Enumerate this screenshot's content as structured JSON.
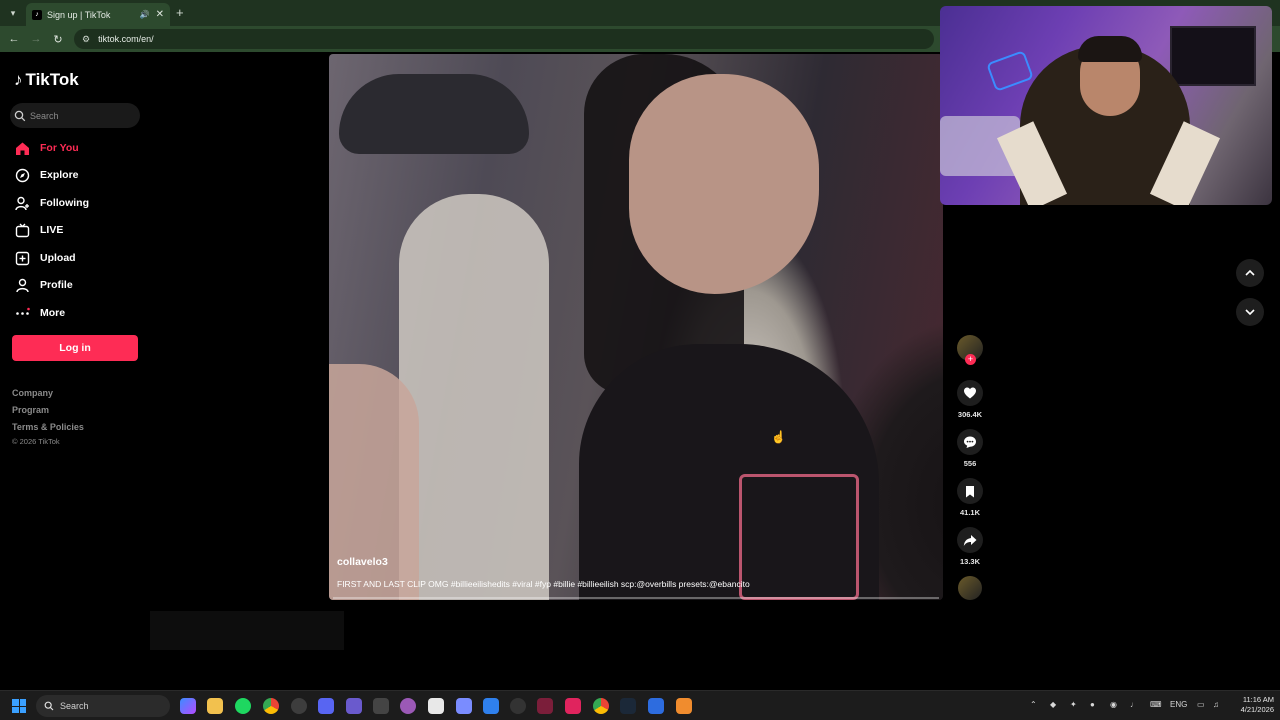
{
  "browser": {
    "tab_title": "Sign up | TikTok",
    "url": "tiktok.com/en/"
  },
  "sidebar": {
    "logo_text": "TikTok",
    "search_placeholder": "Search",
    "items": [
      {
        "label": "For You",
        "icon": "home-icon",
        "active": true
      },
      {
        "label": "Explore",
        "icon": "compass-icon"
      },
      {
        "label": "Following",
        "icon": "user-add-icon"
      },
      {
        "label": "LIVE",
        "icon": "live-tv-icon"
      },
      {
        "label": "Upload",
        "icon": "upload-plus-icon"
      },
      {
        "label": "Profile",
        "icon": "profile-icon"
      },
      {
        "label": "More",
        "icon": "more-dots-icon"
      }
    ],
    "login_label": "Log in",
    "footer_links": [
      "Company",
      "Program",
      "Terms & Policies"
    ],
    "copyright": "© 2026 TikTok"
  },
  "video": {
    "username": "collavelo3",
    "description": "FIRST AND LAST CLIP OMG #billieeilishedits #viral #fyp #billie #billieeilish scp:@overbills presets:@ebancito",
    "progress": 0.0
  },
  "actions": {
    "likes": "306.4K",
    "comments": "556",
    "saves": "41.1K",
    "shares": "13.3K"
  },
  "taskbar": {
    "search_label": "Search",
    "language": "ENG",
    "time": "11:16 AM",
    "date": "4/21/2026"
  },
  "colors": {
    "accent": "#fe2c55",
    "browser_chrome": "#2d4a2e"
  }
}
